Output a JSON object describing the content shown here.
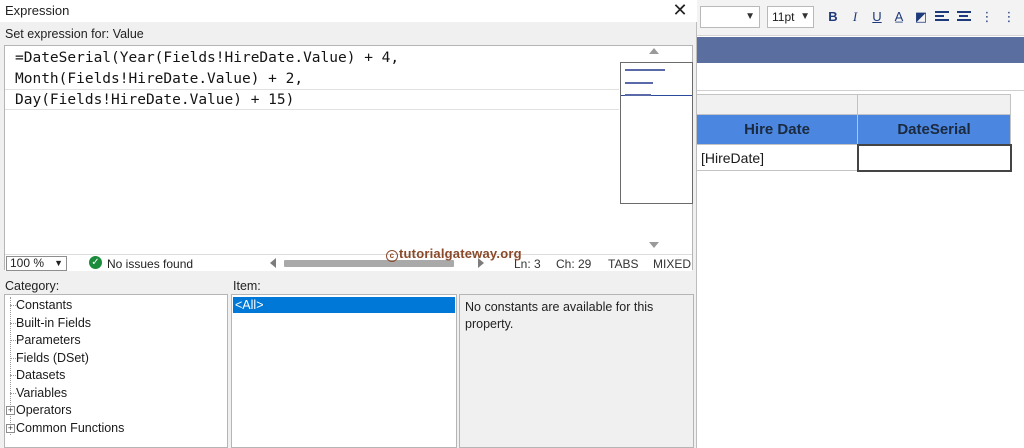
{
  "dialog": {
    "title": "Expression",
    "close_glyph": "✕",
    "set_label": "Set expression for: Value"
  },
  "editor": {
    "lines": [
      "=DateSerial(Year(Fields!HireDate.Value) + 4,",
      "Month(Fields!HireDate.Value) + 2,",
      "Day(Fields!HireDate.Value) + 15)"
    ]
  },
  "status": {
    "zoom": "100 %",
    "issues": "No issues found",
    "line": "Ln: 3",
    "char": "Ch: 29",
    "tabs": "TABS",
    "eol": "MIXED"
  },
  "watermark": {
    "symbol": "c",
    "text": "tutorialgateway.org"
  },
  "category": {
    "label": "Category:",
    "items": [
      {
        "label": "Constants",
        "expandable": false
      },
      {
        "label": "Built-in Fields",
        "expandable": false
      },
      {
        "label": "Parameters",
        "expandable": false
      },
      {
        "label": "Fields (DSet)",
        "expandable": false
      },
      {
        "label": "Datasets",
        "expandable": false
      },
      {
        "label": "Variables",
        "expandable": false
      },
      {
        "label": "Operators",
        "expandable": true
      },
      {
        "label": "Common Functions",
        "expandable": true
      }
    ]
  },
  "item": {
    "label": "Item:",
    "selected": "<All>"
  },
  "description": {
    "text": "No constants are available for this property."
  },
  "designer": {
    "font_size": "11pt",
    "toolbar_icons": [
      "bold-icon",
      "italic-icon",
      "underline-icon",
      "font-color-icon",
      "background-color-icon",
      "align-left-icon",
      "align-center-icon",
      "align-more-icon"
    ],
    "table": {
      "headers": [
        "Hire Date",
        "DateSerial"
      ],
      "row": [
        "[HireDate]",
        ""
      ]
    },
    "colors": {
      "header_band": "#5a6f9f",
      "table_header": "#4b86e0"
    }
  }
}
